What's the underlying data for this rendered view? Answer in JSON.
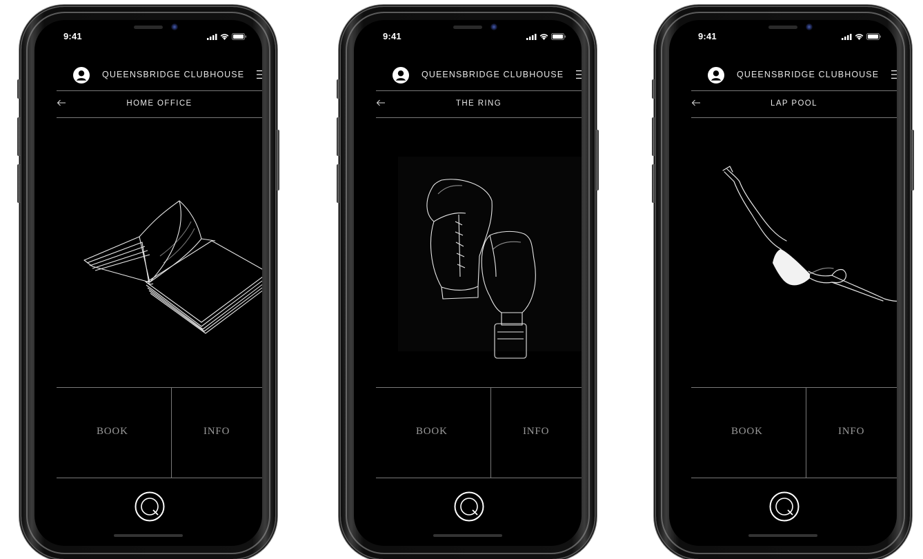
{
  "phones": [
    {
      "status": {
        "time": "9:41"
      },
      "header": {
        "club_name": "QUEENSBRIDGE CLUBHOUSE"
      },
      "section": {
        "title": "HOME OFFICE",
        "illustration": "open-book"
      },
      "actions": {
        "book_label": "BOOK",
        "info_label": "INFO"
      }
    },
    {
      "status": {
        "time": "9:41"
      },
      "header": {
        "club_name": "QUEENSBRIDGE CLUBHOUSE"
      },
      "section": {
        "title": "THE RING",
        "illustration": "boxing-gloves"
      },
      "actions": {
        "book_label": "BOOK",
        "info_label": "INFO"
      }
    },
    {
      "status": {
        "time": "9:41"
      },
      "header": {
        "club_name": "QUEENSBRIDGE CLUBHOUSE"
      },
      "section": {
        "title": "LAP POOL",
        "illustration": "diver"
      },
      "actions": {
        "book_label": "BOOK",
        "info_label": "INFO"
      }
    }
  ],
  "theme": {
    "background": "#000000",
    "text": "#ffffff",
    "divider": "#7a7a7a",
    "action_text": "#9a9a9a"
  }
}
